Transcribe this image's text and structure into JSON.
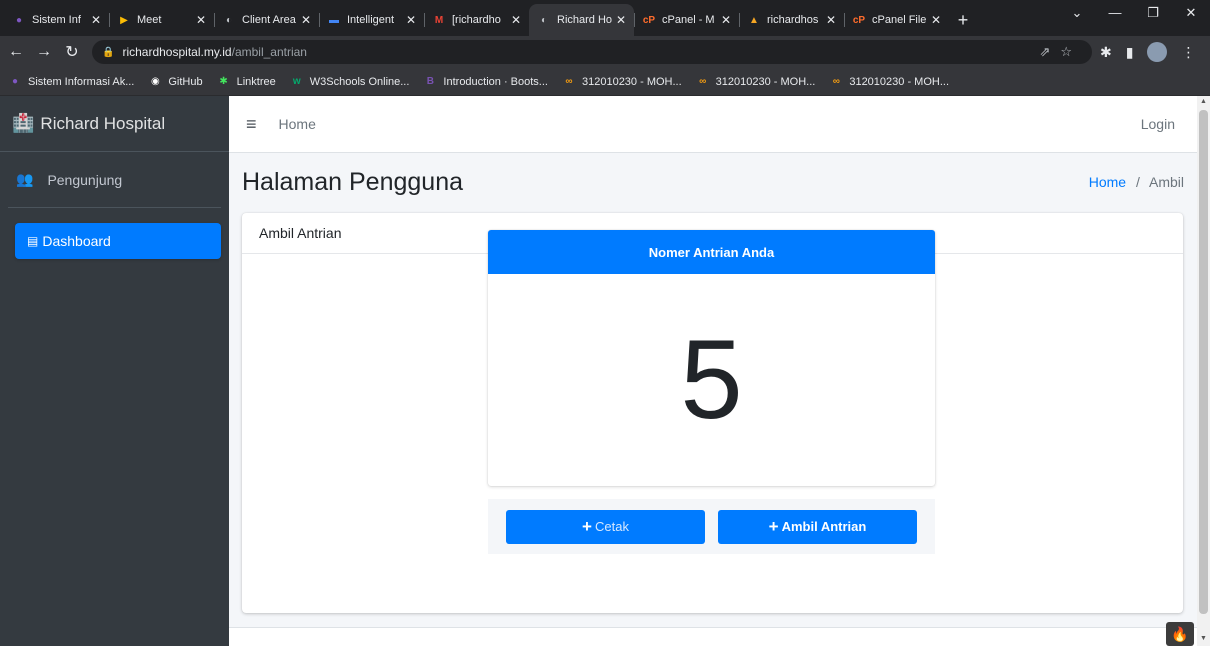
{
  "browser": {
    "tabs": [
      {
        "title": "Sistem Inf",
        "icon": "globe-icon",
        "color": "#7e57c2",
        "glyph": "●"
      },
      {
        "title": "Meet",
        "icon": "meet-icon",
        "color": "#fbbc04",
        "glyph": "▶"
      },
      {
        "title": "Client Area",
        "icon": "client-area-icon",
        "color": "#bdc1c6",
        "glyph": "◐"
      },
      {
        "title": "Intelligent",
        "icon": "intelligent-icon",
        "color": "#4285f4",
        "glyph": "▬"
      },
      {
        "title": "[richardho",
        "icon": "gmail-icon",
        "color": "#ea4335",
        "glyph": "M"
      },
      {
        "title": "Richard Ho",
        "icon": "chrome-icon",
        "color": "#bdc1c6",
        "glyph": "◐",
        "active": true
      },
      {
        "title": "cPanel - M",
        "icon": "cpanel-icon",
        "color": "#ff6c2c",
        "glyph": "cP"
      },
      {
        "title": "richardhos",
        "icon": "richardhos-icon",
        "color": "#f5a623",
        "glyph": "▲"
      },
      {
        "title": "cPanel File",
        "icon": "cpanel-file-icon",
        "color": "#ff6c2c",
        "glyph": "cP"
      }
    ],
    "url": {
      "host": "richardhospital.my.id",
      "path": "/ambil_antrian"
    },
    "bookmarks": [
      {
        "label": "Sistem Informasi Ak...",
        "icon": "globe-icon",
        "color": "#7e57c2",
        "glyph": "●"
      },
      {
        "label": "GitHub",
        "icon": "github-icon",
        "color": "#ffffff",
        "glyph": "◉"
      },
      {
        "label": "Linktree",
        "icon": "linktree-icon",
        "color": "#43e55e",
        "glyph": "✱"
      },
      {
        "label": "W3Schools Online...",
        "icon": "w3schools-icon",
        "color": "#04aa6d",
        "glyph": "w"
      },
      {
        "label": "Introduction · Boots...",
        "icon": "bootstrap-icon",
        "color": "#7952b3",
        "glyph": "B"
      },
      {
        "label": "312010230 - MOH...",
        "icon": "infinity-icon",
        "color": "#f39c12",
        "glyph": "∞"
      },
      {
        "label": "312010230 - MOH...",
        "icon": "infinity-icon",
        "color": "#f39c12",
        "glyph": "∞"
      },
      {
        "label": "312010230 - MOH...",
        "icon": "infinity-icon",
        "color": "#f39c12",
        "glyph": "∞"
      }
    ]
  },
  "sidebar": {
    "brand": "Richard Hospital",
    "user": "Pengunjung",
    "nav": [
      {
        "label": "Dashboard",
        "icon": "dashboard-icon",
        "active": true
      }
    ]
  },
  "topnav": {
    "home": "Home",
    "login": "Login"
  },
  "content": {
    "title": "Halaman Pengguna",
    "breadcrumb": {
      "home": "Home",
      "separator": "/",
      "current": "Ambil"
    },
    "card_title": "Ambil Antrian",
    "queue": {
      "heading": "Nomer Antrian Anda",
      "number": "5"
    },
    "buttons": {
      "print": "Cetak",
      "take": "Ambil Antrian"
    }
  },
  "colors": {
    "primary": "#007bff",
    "sidebar": "#343a40",
    "background": "#f4f6f9"
  }
}
